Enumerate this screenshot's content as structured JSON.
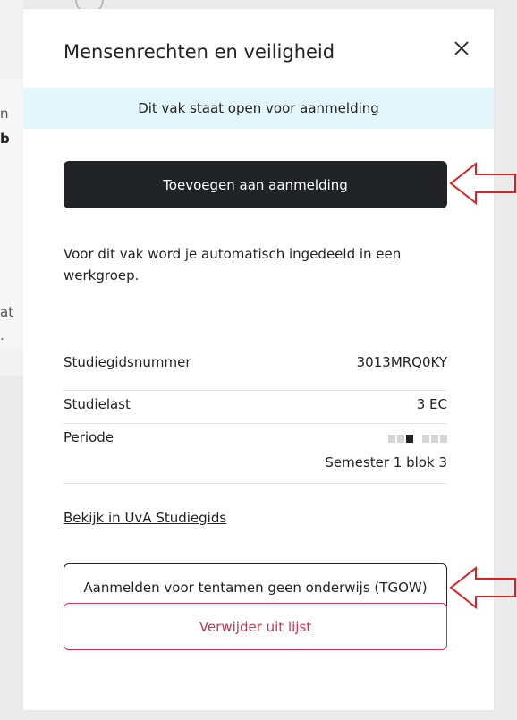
{
  "background": {
    "fragments": [
      "n",
      "b",
      "at",
      "."
    ]
  },
  "modal": {
    "title": "Mensenrechten en veiligheid",
    "close_icon": "close-icon",
    "status_banner": "Dit vak staat open voor aanmelding",
    "add_button_label": "Toevoegen aan aanmelding",
    "info_text": "Voor dit vak word je automatisch ingedeeld in een werkgroep.",
    "details": {
      "study_guide_number": {
        "label": "Studiegidsnummer",
        "value": "3013MRQ0KY"
      },
      "study_load": {
        "label": "Studielast",
        "value": "3 EC"
      },
      "period": {
        "label": "Periode",
        "value": "Semester 1 blok 3",
        "active_block": 3,
        "total_blocks": 6
      }
    },
    "study_guide_link": "Bekijk in UvA Studiegids",
    "tgow_button_label": "Aanmelden voor tentamen geen onderwijs (TGOW)",
    "remove_button_label": "Verwijder uit lijst"
  },
  "colors": {
    "banner_bg": "#e3f6fb",
    "primary_button_bg": "#222326",
    "danger": "#d0344e",
    "annotation_arrow": "#e02020"
  }
}
